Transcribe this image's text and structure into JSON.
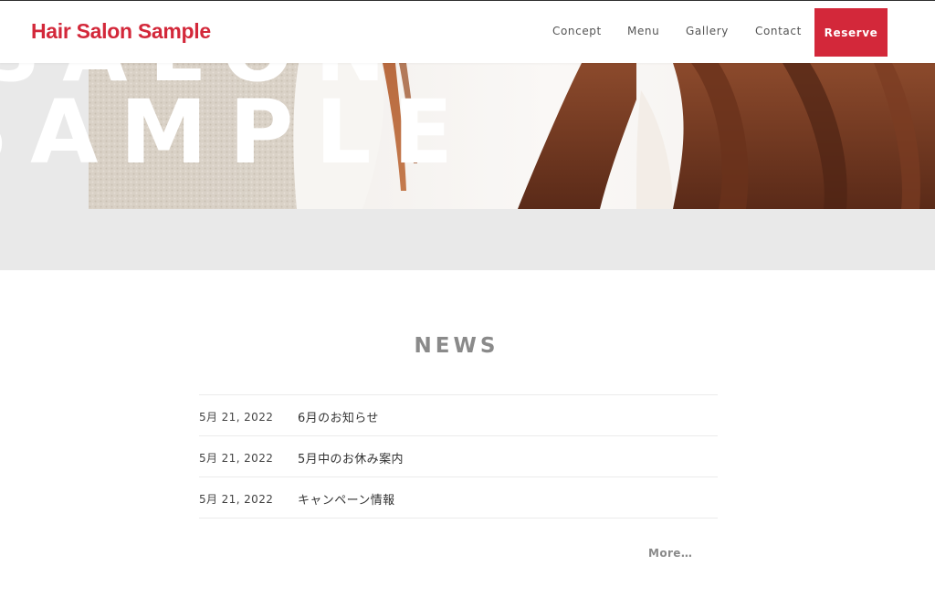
{
  "header": {
    "logo": "Hair Salon Sample",
    "nav": {
      "concept": "Concept",
      "menu": "Menu",
      "gallery": "Gallery",
      "contact": "Contact"
    },
    "reserve_label": "Reserve"
  },
  "hero": {
    "overlay_line1": "SALON",
    "overlay_line2": "SAMPLE"
  },
  "news": {
    "title": "NEWS",
    "items": [
      {
        "date": "5月 21, 2022",
        "headline": "6月のお知らせ"
      },
      {
        "date": "5月 21, 2022",
        "headline": "5月中のお休み案内"
      },
      {
        "date": "5月 21, 2022",
        "headline": "キャンペーン情報"
      }
    ],
    "more_label": "More…"
  },
  "colors": {
    "brand": "#d3283a",
    "news_title": "#8a8a8a",
    "hero_band": "#e9e9e9"
  }
}
